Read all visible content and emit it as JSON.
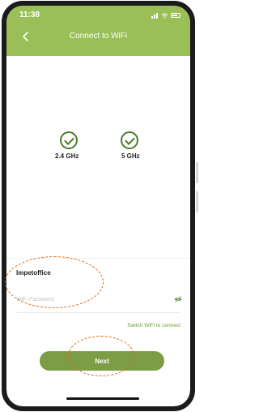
{
  "status_bar": {
    "time": "11:38",
    "signal_icon": "signal-icon",
    "wifi_icon": "wifi-icon",
    "battery_icon": "battery-icon"
  },
  "nav": {
    "title": "Connect to WiFi",
    "back_icon": "chevron-left-icon"
  },
  "bands": [
    {
      "label": "2.4 GHz",
      "icon": "check-circle-icon"
    },
    {
      "label": "5 GHz",
      "icon": "check-circle-icon"
    }
  ],
  "network": {
    "name": "Impetoffice"
  },
  "password": {
    "placeholder": "WiFi Password",
    "value": "",
    "toggle_icon": "eye-off-icon"
  },
  "switch_wifi_link": "Switch WiFi to connect",
  "next_button": "Next",
  "colors": {
    "header": "#9bbf57",
    "button": "#7c9c46",
    "check": "#4e7a2c",
    "annotation": "#e26b16",
    "link": "#6f9b37"
  }
}
